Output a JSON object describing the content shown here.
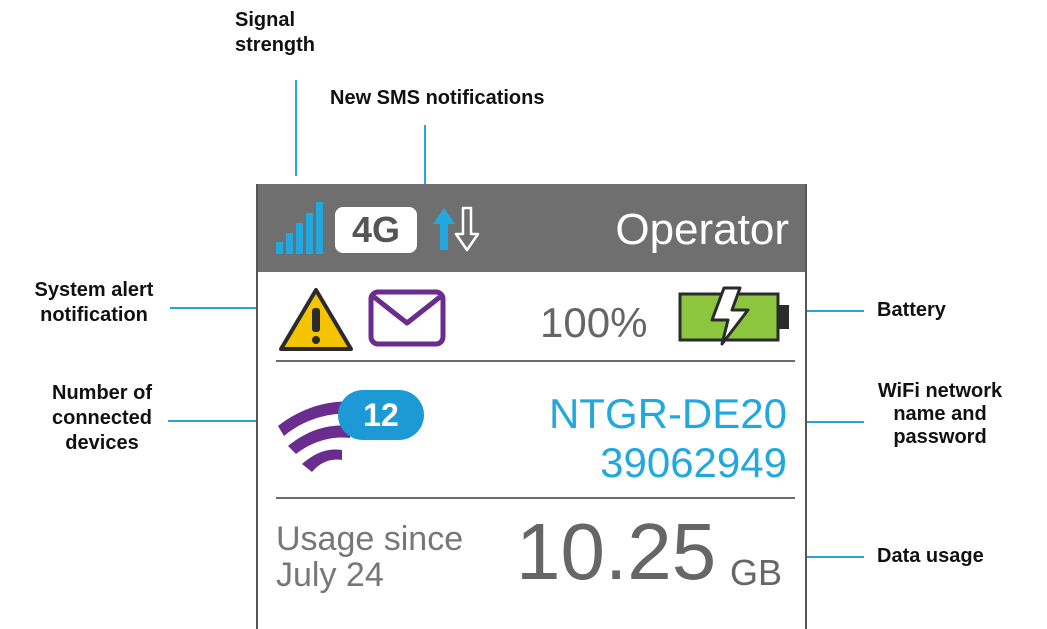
{
  "callouts": {
    "signal": "Signal strength",
    "signal_line1": "Signal",
    "signal_line2": "strength",
    "sms": "New SMS notifications",
    "alert_line1": "System alert",
    "alert_line2": "notification",
    "battery": "Battery",
    "devices_line1": "Number of",
    "devices_line2": "connected",
    "devices_line3": "devices",
    "wifi_line1": "WiFi network",
    "wifi_line2": "name and",
    "wifi_line3": "password",
    "data_usage": "Data usage"
  },
  "screen": {
    "network_type": "4G",
    "operator": "Operator",
    "battery_percent": "100%",
    "connected_devices": "12",
    "wifi_ssid": "NTGR-DE20",
    "wifi_password": "39062949",
    "usage_label_line1": "Usage since",
    "usage_label_line2": "July 24",
    "usage_value": "10.25",
    "usage_unit": "GB"
  },
  "icons": {
    "signal": "signal-bars-icon",
    "transfer": "up-down-arrows-icon",
    "alert": "warning-triangle-icon",
    "sms": "envelope-icon",
    "battery": "charging-battery-icon",
    "wifi": "wifi-icon"
  },
  "colors": {
    "status_bar": "#6f6f70",
    "accent_blue": "#22a8df",
    "battery_green": "#8cc63f",
    "wifi_purple": "#6a2c8e",
    "warning_yellow": "#f5c400"
  }
}
